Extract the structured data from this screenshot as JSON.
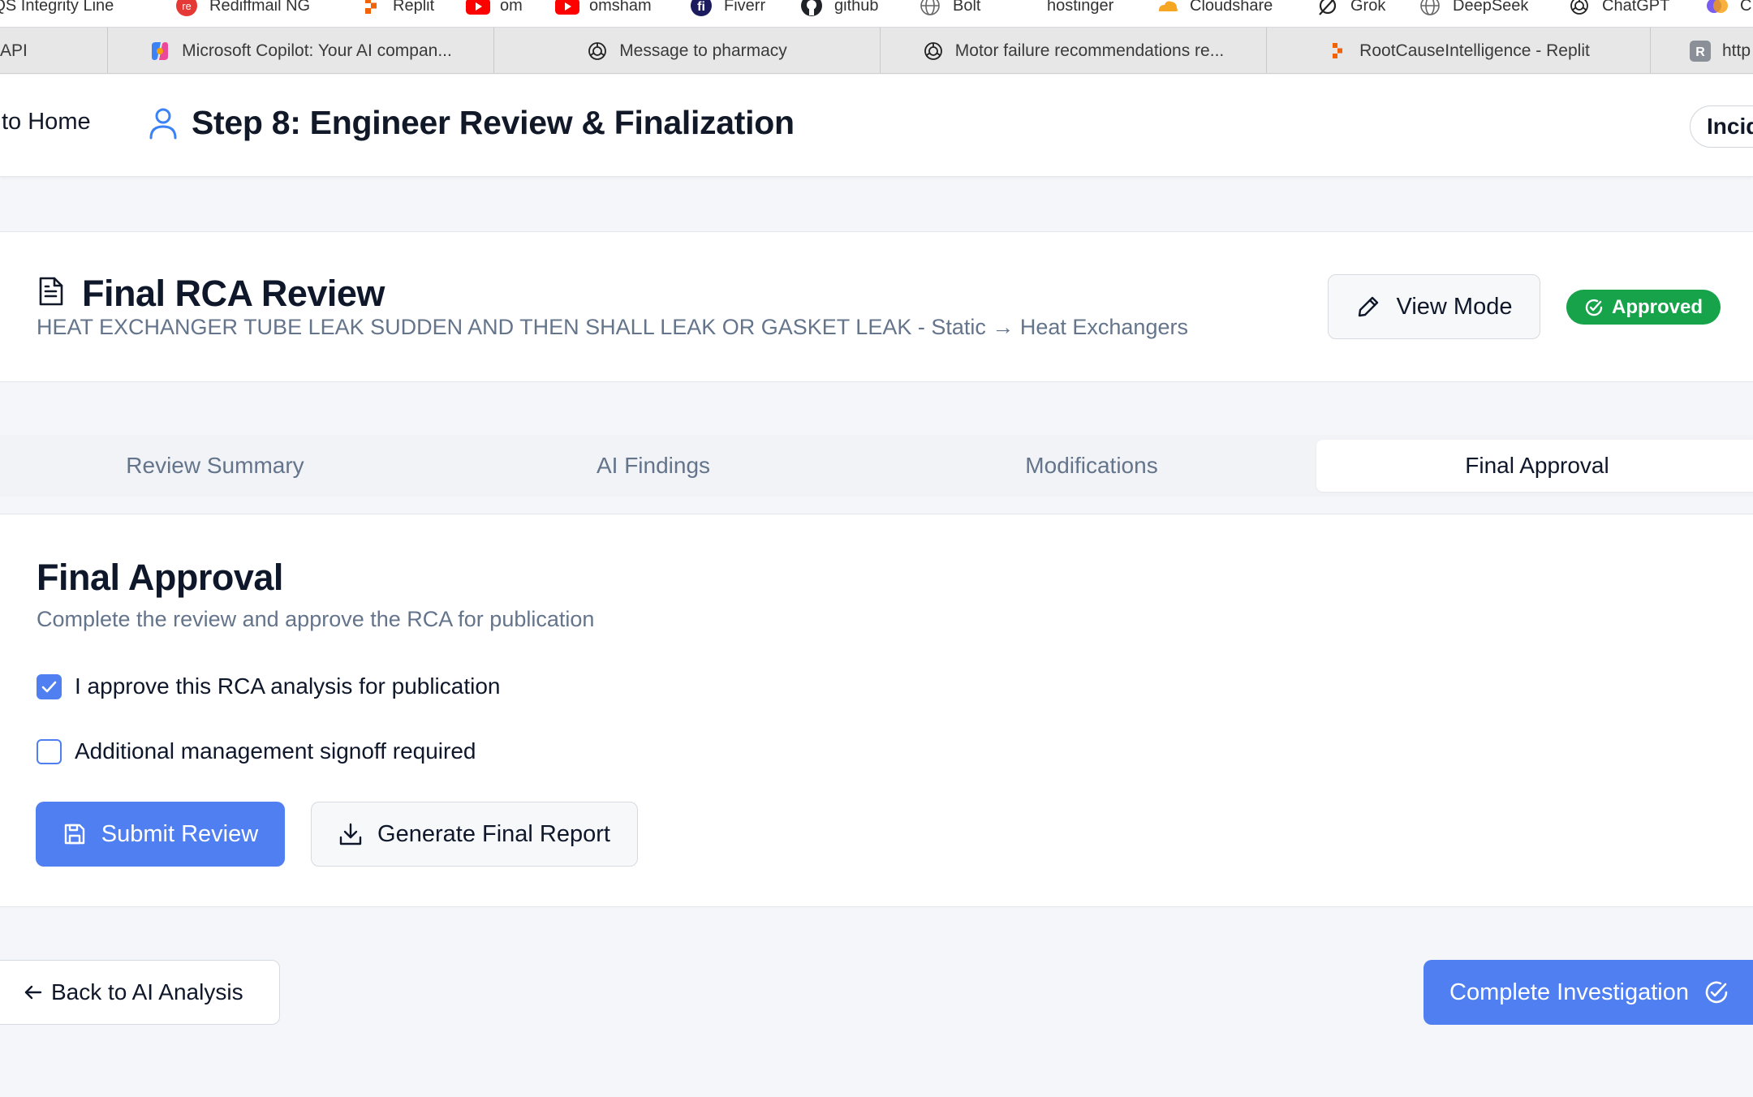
{
  "bookmarks": [
    {
      "label": "EQS Integrity Line",
      "icon": "eqs-icon"
    },
    {
      "label": "Rediffmail NG",
      "icon": "rediff-icon",
      "color": "#e53935"
    },
    {
      "label": "Replit",
      "icon": "replit-icon",
      "color": "#f26207"
    },
    {
      "label": "om",
      "icon": "youtube-icon",
      "color": "#ff0000"
    },
    {
      "label": "omsham",
      "icon": "youtube-icon",
      "color": "#ff0000"
    },
    {
      "label": "Fiverr",
      "icon": "fiverr-icon",
      "color": "#1b1b5e"
    },
    {
      "label": "github",
      "icon": "github-icon"
    },
    {
      "label": "Bolt",
      "icon": "globe-icon"
    },
    {
      "label": "hostinger",
      "icon": ""
    },
    {
      "label": "Cloudshare",
      "icon": "cloud-icon",
      "color": "#f5a623"
    },
    {
      "label": "Grok",
      "icon": "grok-icon"
    },
    {
      "label": "DeepSeek",
      "icon": "globe-icon"
    },
    {
      "label": "ChatGPT",
      "icon": "openai-icon"
    },
    {
      "label": "C",
      "icon": "copilot-icon"
    }
  ],
  "browser_tabs": [
    {
      "label": "API",
      "icon": ""
    },
    {
      "label": "Microsoft Copilot: Your AI compan...",
      "icon": "copilot-icon"
    },
    {
      "label": "Message to pharmacy",
      "icon": "openai-icon"
    },
    {
      "label": "Motor failure recommendations re...",
      "icon": "openai-icon"
    },
    {
      "label": "RootCauseIntelligence - Replit",
      "icon": "replit-icon"
    },
    {
      "label": "http",
      "icon": "r-icon"
    }
  ],
  "header": {
    "home_link": "to Home",
    "step_title": "Step 8: Engineer Review & Finalization",
    "incident_chip": "Incid"
  },
  "review": {
    "title": "Final RCA Review",
    "subtitle": "HEAT EXCHANGER TUBE LEAK SUDDEN AND THEN SHALL LEAK OR GASKET LEAK - Static → Heat Exchangers",
    "view_mode_label": "View Mode",
    "status_badge": "Approved"
  },
  "tabs": [
    {
      "label": "Review Summary",
      "active": false
    },
    {
      "label": "AI Findings",
      "active": false
    },
    {
      "label": "Modifications",
      "active": false
    },
    {
      "label": "Final Approval",
      "active": true
    }
  ],
  "approval": {
    "title": "Final Approval",
    "description": "Complete the review and approve the RCA for publication",
    "checkboxes": [
      {
        "label": "I approve this RCA analysis for publication",
        "checked": true
      },
      {
        "label": "Additional management signoff required",
        "checked": false
      }
    ],
    "submit_label": "Submit Review",
    "report_label": "Generate Final Report"
  },
  "footer": {
    "back_label": "Back to AI Analysis",
    "complete_label": "Complete Investigation"
  },
  "colors": {
    "primary": "#4f7ff0",
    "success": "#16a34a",
    "muted_text": "#64748b",
    "page_bg": "#f5f6fa"
  }
}
